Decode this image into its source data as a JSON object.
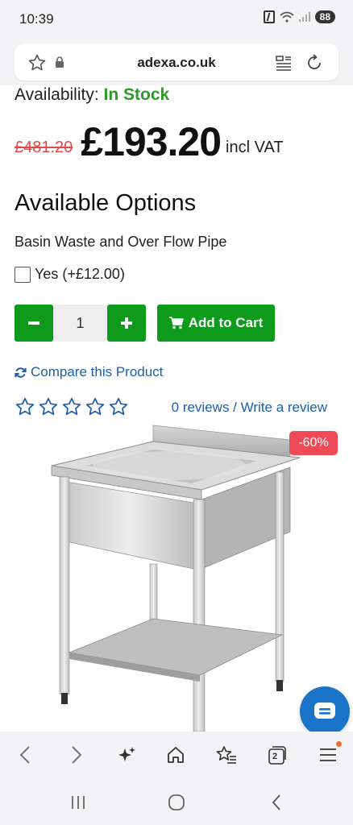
{
  "status_bar": {
    "time": "10:39",
    "battery": "88"
  },
  "browser": {
    "url": "adexa.co.uk",
    "tab_count": "2"
  },
  "product": {
    "availability_label": "Availability:",
    "availability_value": "In Stock",
    "old_price": "£481.20",
    "new_price": "£193.20",
    "vat_label": "incl VAT",
    "discount_badge": "-60%"
  },
  "options": {
    "heading": "Available Options",
    "option_label": "Basin Waste and Over Flow Pipe",
    "checkbox_label": "Yes (+£12.00)"
  },
  "cart": {
    "minus_label": "−",
    "quantity": "1",
    "plus_label": "+",
    "add_label": "Add to Cart"
  },
  "compare_label": "Compare this Product",
  "rating": {
    "stars": 0,
    "max_stars": 5,
    "reviews_text": "0 reviews / Write a review"
  },
  "icons": {
    "cart": "cart-icon",
    "compare": "refresh-icon",
    "chat": "chat-icon"
  },
  "colors": {
    "green_button": "#0e9a1a",
    "in_stock": "#2a9a2a",
    "link": "#1d5fa8",
    "old_price": "#e24a4a",
    "badge": "#ef4b56",
    "chat": "#1a74c8"
  }
}
